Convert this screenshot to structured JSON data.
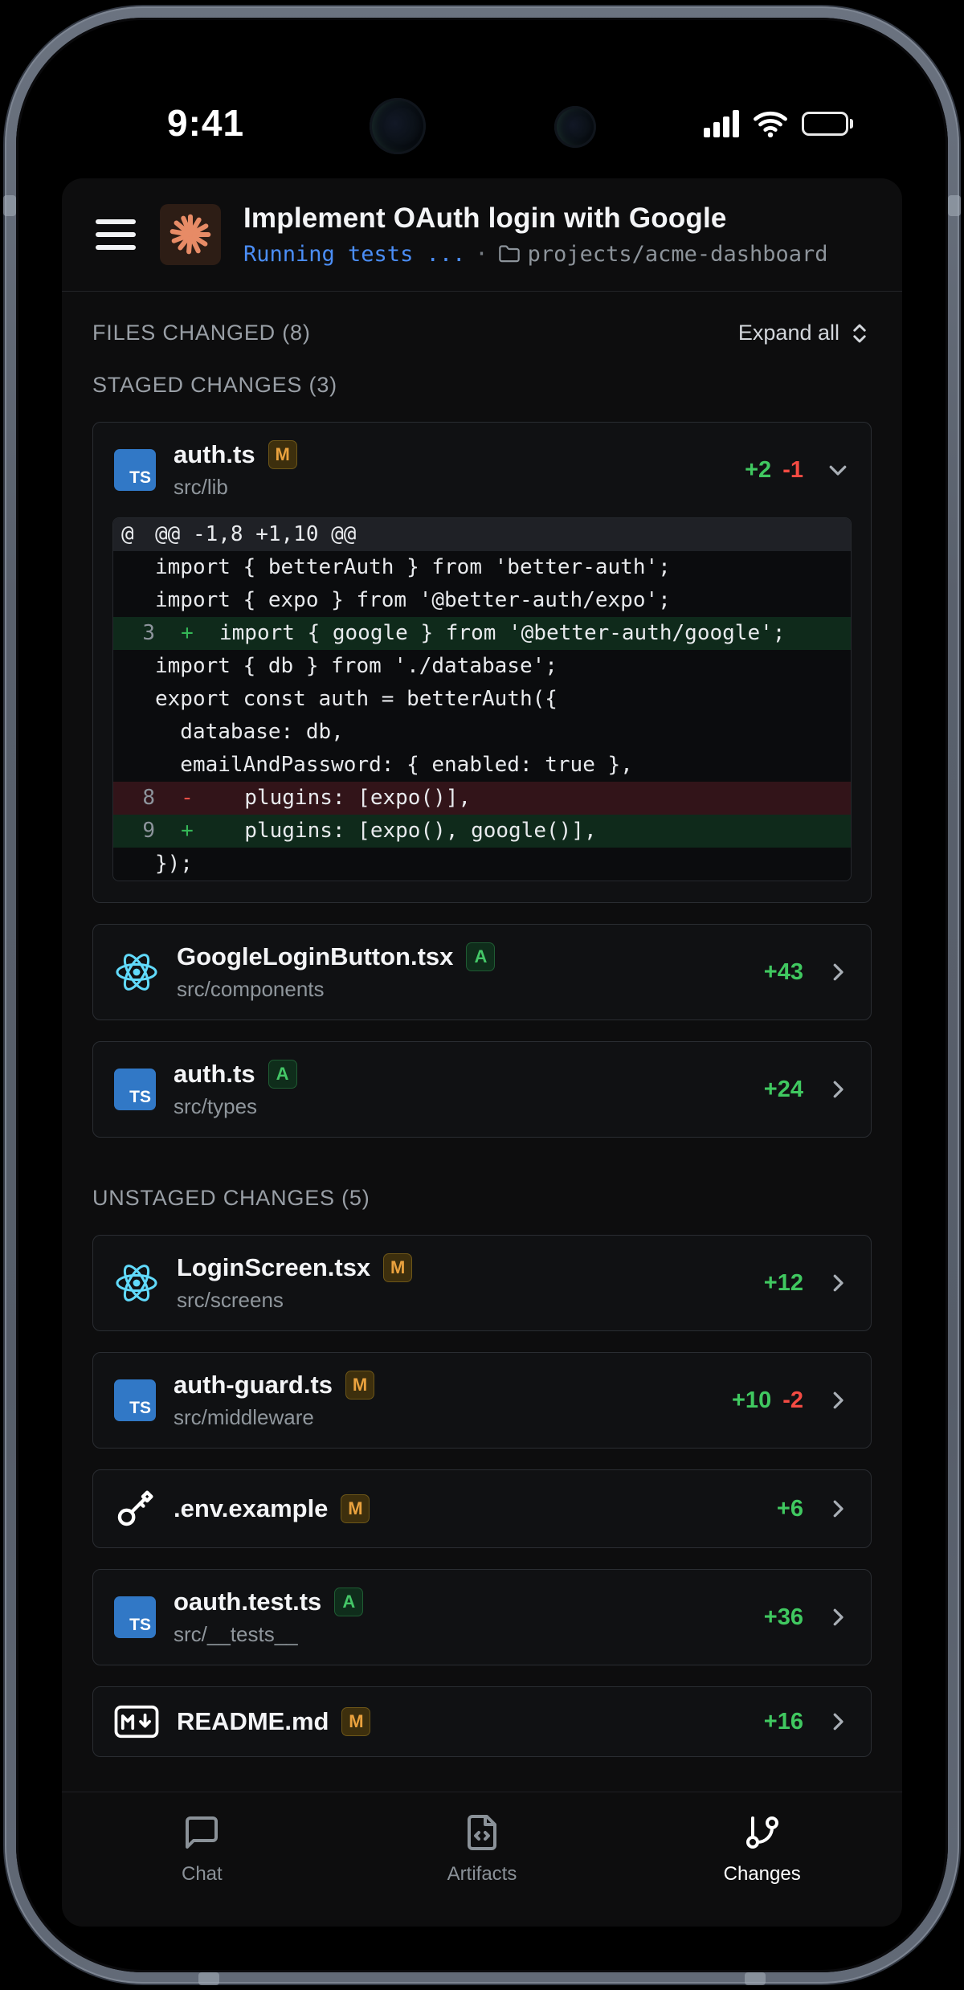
{
  "status_bar": {
    "time": "9:41"
  },
  "header": {
    "title": "Implement OAuth login with Google",
    "status": "Running tests ...",
    "separator": "·",
    "project": "projects/acme-dashboard"
  },
  "sections": {
    "files_changed": "FILES CHANGED (8)",
    "expand_all": "Expand all",
    "staged": "STAGED CHANGES (3)",
    "unstaged": "UNSTAGED CHANGES (5)"
  },
  "staged": [
    {
      "name": "auth.ts",
      "badge": "M",
      "path": "src/lib",
      "added": "+2",
      "removed": "-1",
      "icon": "typescript-icon",
      "chevron": "down",
      "expanded": true
    },
    {
      "name": "GoogleLoginButton.tsx",
      "badge": "A",
      "path": "src/components",
      "added": "+43",
      "removed": "",
      "icon": "react-icon",
      "chevron": "right",
      "expanded": false
    },
    {
      "name": "auth.ts",
      "badge": "A",
      "path": "src/types",
      "added": "+24",
      "removed": "",
      "icon": "typescript-icon",
      "chevron": "right",
      "expanded": false
    }
  ],
  "unstaged": [
    {
      "name": "LoginScreen.tsx",
      "badge": "M",
      "path": "src/screens",
      "added": "+12",
      "removed": "",
      "icon": "react-icon",
      "chevron": "right",
      "expanded": false
    },
    {
      "name": "auth-guard.ts",
      "badge": "M",
      "path": "src/middleware",
      "added": "+10",
      "removed": "-2",
      "icon": "typescript-icon",
      "chevron": "right",
      "expanded": false
    },
    {
      "name": ".env.example",
      "badge": "M",
      "path": "",
      "added": "+6",
      "removed": "",
      "icon": "key-icon",
      "chevron": "right",
      "expanded": false
    },
    {
      "name": "oauth.test.ts",
      "badge": "A",
      "path": "src/__tests__",
      "added": "+36",
      "removed": "",
      "icon": "typescript-icon",
      "chevron": "right",
      "expanded": false
    },
    {
      "name": "README.md",
      "badge": "M",
      "path": "",
      "added": "+16",
      "removed": "",
      "icon": "markdown-icon",
      "chevron": "right",
      "expanded": false
    }
  ],
  "diff": {
    "rows": [
      {
        "t": "hunk",
        "n": "@",
        "s": "",
        "c": "@@ -1,8 +1,10 @@"
      },
      {
        "t": "ctx",
        "n": "",
        "s": "",
        "c": "import { betterAuth } from 'better-auth';"
      },
      {
        "t": "ctx",
        "n": "",
        "s": "",
        "c": "import { expo } from '@better-auth/expo';"
      },
      {
        "t": "add",
        "n": "3",
        "s": "+",
        "c": "import { google } from '@better-auth/google';"
      },
      {
        "t": "ctx",
        "n": "",
        "s": "",
        "c": "import { db } from './database';"
      },
      {
        "t": "ctx",
        "n": "",
        "s": "",
        "c": "export const auth = betterAuth({"
      },
      {
        "t": "ctx",
        "n": "",
        "s": "",
        "c": "  database: db,"
      },
      {
        "t": "ctx",
        "n": "",
        "s": "",
        "c": "  emailAndPassword: { enabled: true },"
      },
      {
        "t": "del",
        "n": "8",
        "s": "-",
        "c": "  plugins: [expo()],"
      },
      {
        "t": "add",
        "n": "9",
        "s": "+",
        "c": "  plugins: [expo(), google()],"
      },
      {
        "t": "ctx",
        "n": "",
        "s": "",
        "c": "});"
      }
    ]
  },
  "tabs": [
    {
      "id": "chat",
      "label": "Chat",
      "icon": "chat-icon",
      "active": false
    },
    {
      "id": "artifacts",
      "label": "Artifacts",
      "icon": "artifact-icon",
      "active": false
    },
    {
      "id": "changes",
      "label": "Changes",
      "icon": "git-branch-icon",
      "active": true
    }
  ],
  "colors": {
    "accent_blue": "#4b8ef7",
    "add_green": "#40c860",
    "del_red": "#f44b43",
    "ts_blue": "#3178c6",
    "react_cyan": "#61dafb",
    "badge_modified": "#eaa23e",
    "badge_added": "#44c767",
    "logo_coral": "#e78b66",
    "bezel_gray": "#5d6471"
  }
}
